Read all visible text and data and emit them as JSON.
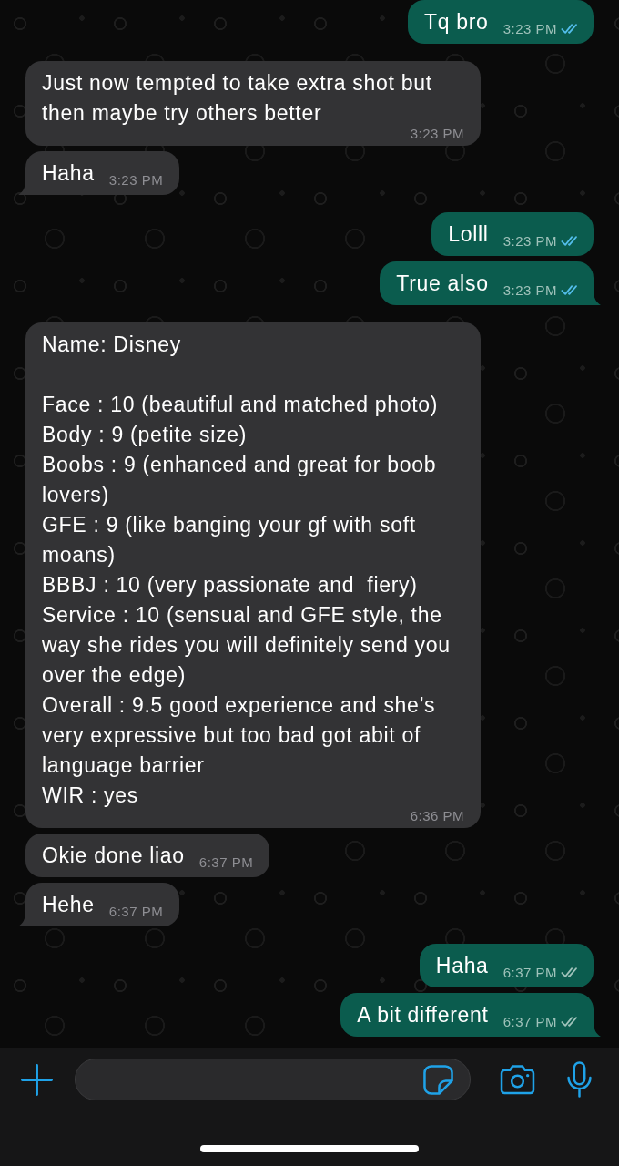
{
  "messages": [
    {
      "kind": "outgoing",
      "text": "Tq bro",
      "time": "3:23 PM",
      "read": true,
      "tail": false
    },
    {
      "kind": "incoming",
      "text": "Just now tempted to take extra shot but then maybe try others better",
      "time": "3:23 PM",
      "tail": false
    },
    {
      "kind": "incoming",
      "text": "Haha",
      "time": "3:23 PM",
      "tail": true
    },
    {
      "kind": "outgoing",
      "text": "Lolll",
      "time": "3:23 PM",
      "read": true,
      "tail": false
    },
    {
      "kind": "outgoing",
      "text": "True also",
      "time": "3:23 PM",
      "read": true,
      "tail": true
    },
    {
      "kind": "incoming",
      "text": "Name: Disney\n\nFace : 10 (beautiful and matched photo)\nBody : 9 (petite size)\nBoobs : 9 (enhanced and great for boob lovers)\nGFE : 9 (like banging your gf with soft moans)\nBBBJ : 10 (very passionate and  fiery)\nService : 10 (sensual and GFE style, the way she rides you will definitely send you over the edge)\nOverall : 9.5 good experience and she’s very expressive but too bad got abit of language barrier\nWIR : yes",
      "time": "6:36 PM",
      "tail": false
    },
    {
      "kind": "incoming",
      "text": "Okie done liao",
      "time": "6:37 PM",
      "tail": false
    },
    {
      "kind": "incoming",
      "text": "Hehe",
      "time": "6:37 PM",
      "tail": true
    },
    {
      "kind": "outgoing",
      "text": "Haha",
      "time": "6:37 PM",
      "read": false,
      "tail": false
    },
    {
      "kind": "outgoing",
      "text": "A bit different",
      "time": "6:37 PM",
      "read": false,
      "tail": true
    }
  ]
}
